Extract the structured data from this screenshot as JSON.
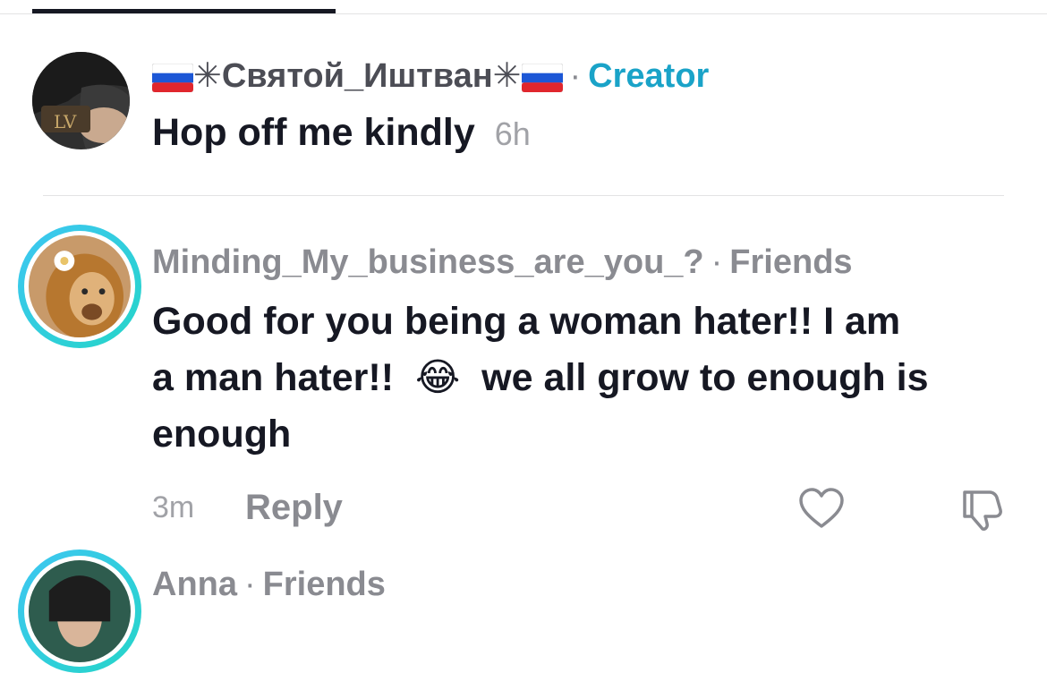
{
  "comments": [
    {
      "username": "✳Святой_Иштван✳",
      "tag": "Creator",
      "text": "Hop off me kindly",
      "time": "6h"
    },
    {
      "username": "Minding_My_business_are_you_?",
      "tag": "Friends",
      "text_line1": "Good for you being a woman hater!! I am",
      "text_line2_start": "a man hater!!",
      "emoji": "😂",
      "text_line2_end": "we all grow to enough is",
      "text_line3": "enough",
      "time": "3m",
      "reply_label": "Reply"
    },
    {
      "username": "Anna",
      "tag": "Friends"
    }
  ],
  "separator": "·",
  "colors": {
    "creator": "#1aa3c8",
    "muted": "#8a8b91",
    "text": "#161823",
    "ring_start": "#3ec6f2",
    "ring_end": "#25d5c8"
  },
  "icons": [
    "russia-flag-icon",
    "heart-icon",
    "dislike-icon",
    "laughing-emoji-icon"
  ]
}
